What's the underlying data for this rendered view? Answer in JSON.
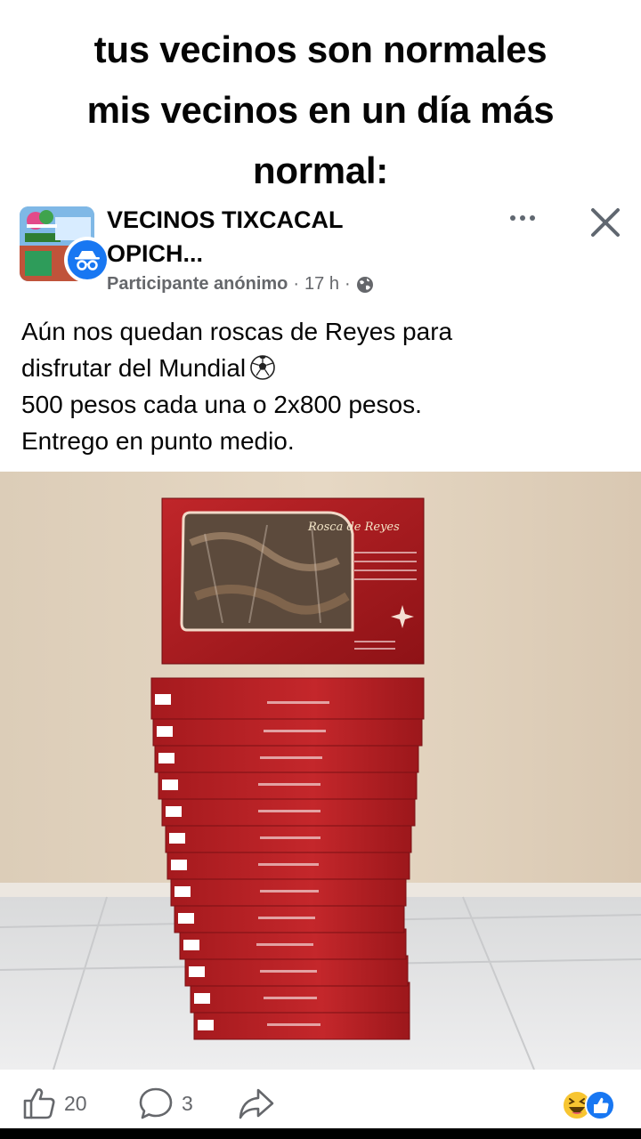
{
  "meme": {
    "caption_lines": [
      "tus vecinos son normales",
      "mis vecinos en un día más",
      "normal:"
    ]
  },
  "post": {
    "group_name_line1": "VECINOS TIXCACAL",
    "group_name_line2": "OPICH...",
    "author": "Participante anónimo",
    "separator": "·",
    "time": "17 h",
    "audience_icon": "globe-icon",
    "more_icon": "more-options-icon",
    "close_icon": "close-icon",
    "text_lines": [
      "Aún nos quedan roscas de Reyes para",
      "disfrutar del Mundial",
      "500 pesos cada una o 2x800 pesos.",
      "Entrego en punto medio."
    ],
    "emoji_icon": "soccer-ball-icon",
    "photo": {
      "box_label": "Rosca de Reyes",
      "stacked_boxes": 13
    }
  },
  "actions": {
    "like_count": "20",
    "comment_count": "3",
    "like_icon": "thumbs-up-icon",
    "comment_icon": "comment-icon",
    "share_icon": "share-icon",
    "reaction_icons": [
      "haha-reaction-icon",
      "like-reaction-icon"
    ]
  },
  "colors": {
    "accent": "#1877f2",
    "text": "#050505",
    "secondary_text": "#65676b",
    "box_red": "#b01e22"
  }
}
